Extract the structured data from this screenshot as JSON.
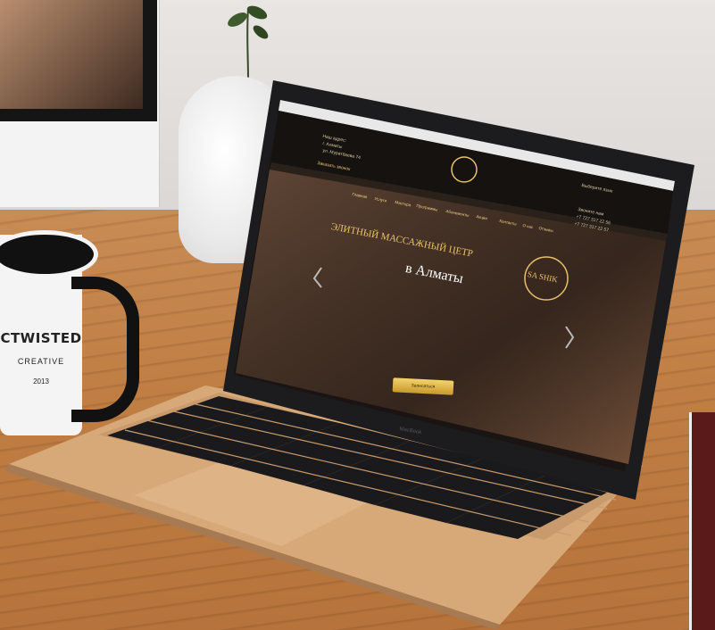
{
  "mug": {
    "brand": "CTWISTED",
    "sub": "CREATIVE",
    "small": "2013"
  },
  "website": {
    "address_title": "Наш адрес:",
    "address_city": "г. Алматы",
    "address_street": "ул. Муратбаева 74",
    "address_link": "Заказать звонок",
    "header_right_label": "Выберите язык",
    "header_right_phone_title": "Звоните нам",
    "phone_1": "+7 727 317 22 56",
    "phone_2": "+7 727 317 22 57",
    "nav": [
      "Главная",
      "Услуги",
      "Мастера",
      "Программы",
      "Абонементы",
      "Акции",
      "Контакты",
      "О нас",
      "Отзывы"
    ],
    "hero_title": "ЭЛИТНЫЙ МАССАЖНЫЙ ЦЕТР",
    "hero_subtitle": "в Алматы",
    "logo_text": "SA SHIK",
    "hero_cta": "Записаться",
    "laptop_brand": "MacBook"
  },
  "colors": {
    "gold": "#e9c16c",
    "screen_bg": "#1a1512",
    "laptop_body": "#d8a97a",
    "keys": "#1a1a1c"
  }
}
